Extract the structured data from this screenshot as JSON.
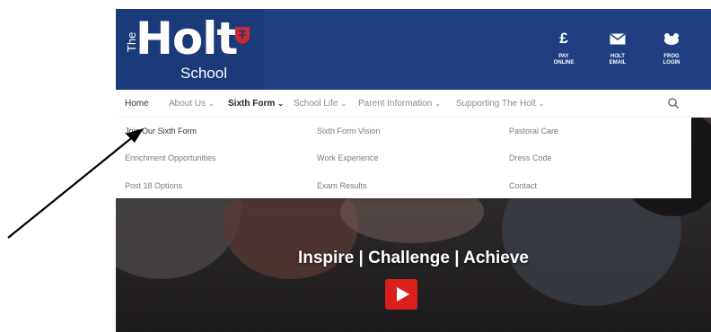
{
  "brand": {
    "the": "The",
    "holt": "Holt",
    "school": "School",
    "accent_red": "#d22630",
    "navy": "#1f3f82"
  },
  "header_links": [
    {
      "icon": "pound-icon",
      "glyph": "£",
      "label": "PAY ONLINE"
    },
    {
      "icon": "mail-icon",
      "glyph": "",
      "label": "HOLT EMAIL"
    },
    {
      "icon": "frog-icon",
      "glyph": "",
      "label": "FROG LOGIN"
    }
  ],
  "nav": {
    "items": [
      "Home",
      "About Us",
      "Sixth Form",
      "School Life",
      "Parent Information",
      "Supporting The Holt"
    ],
    "search_icon": "search-icon"
  },
  "dropdown": {
    "col1": [
      "Join Our Sixth Form",
      "Enrichment Opportunities",
      "Post 18 Options"
    ],
    "col2": [
      "Sixth Form Vision",
      "Work Experience",
      "Exam Results"
    ],
    "col3": [
      "Pastoral Care",
      "Dress Code",
      "Contact"
    ]
  },
  "hero": {
    "tagline": "Inspire | Challenge | Achieve",
    "play_icon": "play-icon"
  }
}
